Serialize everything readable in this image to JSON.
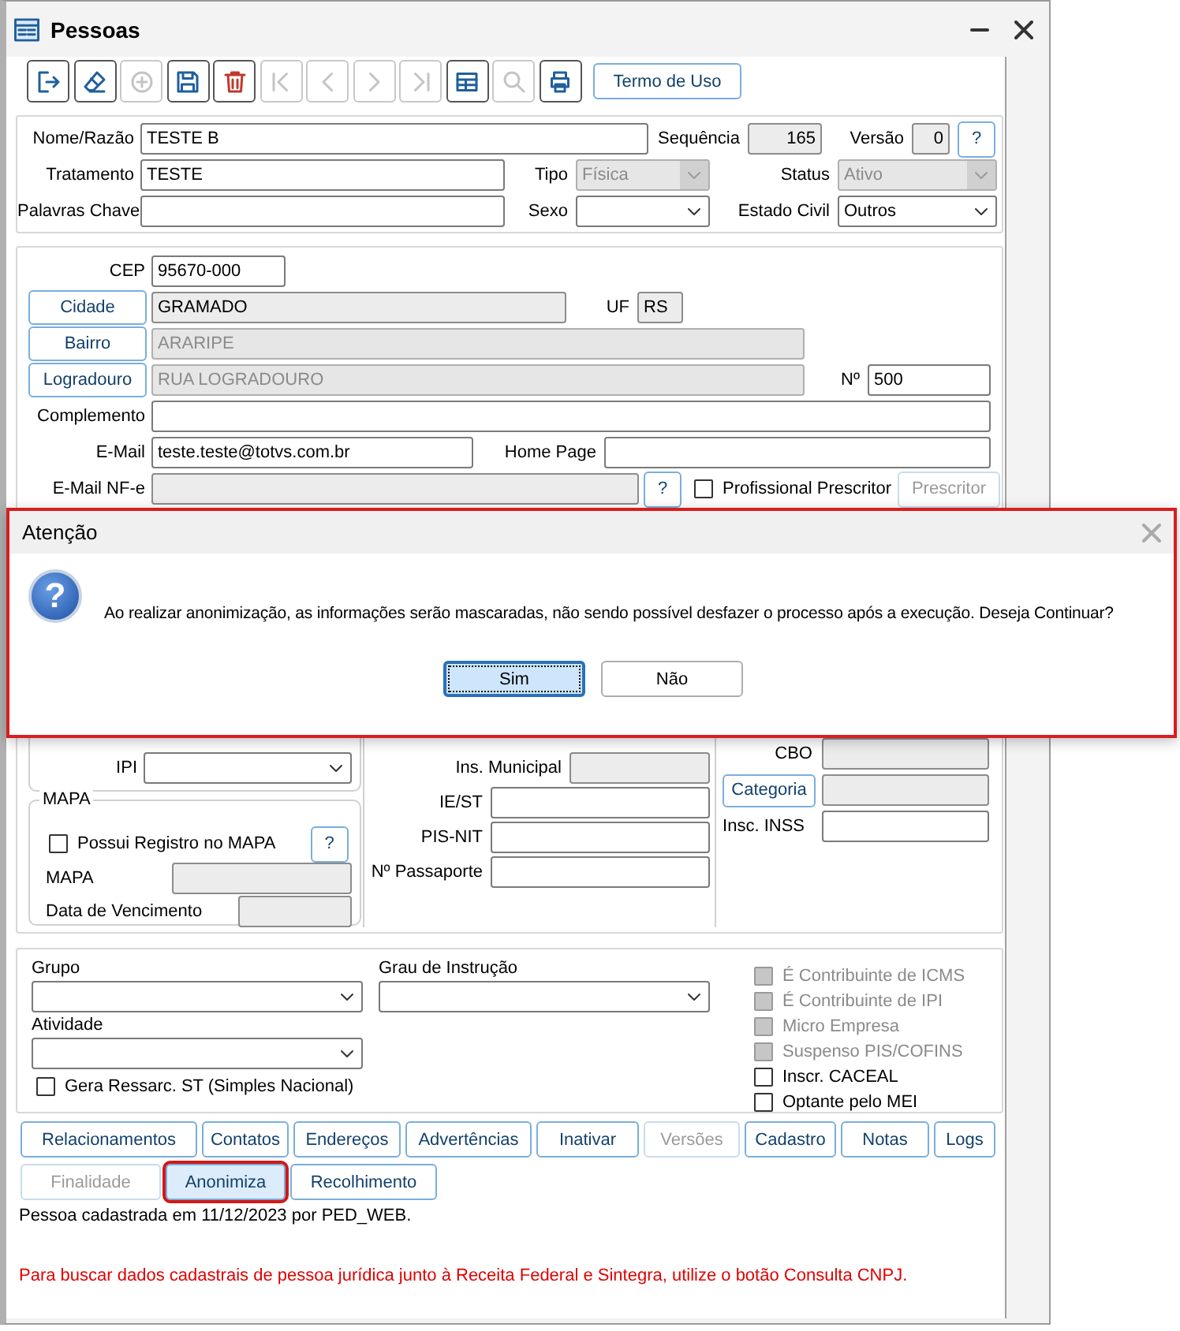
{
  "window": {
    "title": "Pessoas"
  },
  "toolbar": {
    "tools": [
      {
        "kind": "exit",
        "disabled": false
      },
      {
        "kind": "eraser",
        "disabled": false
      },
      {
        "kind": "add",
        "disabled": true
      },
      {
        "kind": "save",
        "disabled": false
      },
      {
        "kind": "delete",
        "disabled": false
      },
      {
        "kind": "first",
        "disabled": true
      },
      {
        "kind": "prev",
        "disabled": true
      },
      {
        "kind": "next",
        "disabled": true
      },
      {
        "kind": "last",
        "disabled": true
      },
      {
        "kind": "grid",
        "disabled": false
      },
      {
        "kind": "search",
        "disabled": true
      },
      {
        "kind": "print",
        "disabled": false
      }
    ],
    "terms_button": "Termo de Uso"
  },
  "identity": {
    "name": {
      "label": "Nome/Razão",
      "value": "TESTE B",
      "readonly": false,
      "disabled": false
    },
    "sequence": {
      "label": "Sequência",
      "value": "165",
      "readonly": true,
      "disabled": false
    },
    "version": {
      "label": "Versão",
      "value": "0",
      "readonly": true,
      "disabled": false
    },
    "help_button": "?",
    "treatment": {
      "label": "Tratamento",
      "value": "TESTE",
      "readonly": false,
      "disabled": false
    },
    "type": {
      "label": "Tipo",
      "value": "Física",
      "disabled": true
    },
    "status": {
      "label": "Status",
      "value": "Ativo",
      "disabled": true
    },
    "keywords": {
      "label": "Palavras Chave",
      "readonly": false,
      "disabled": false
    },
    "sex": {
      "label": "Sexo",
      "readonly": false,
      "disabled": false
    },
    "marital_status": {
      "label": "Estado Civil",
      "value": "Outros",
      "readonly": false,
      "disabled": false
    }
  },
  "address": {
    "cep": {
      "label": "CEP",
      "value": "95670-000",
      "readonly": false,
      "disabled": false
    },
    "city": {
      "button": "Cidade",
      "value": "GRAMADO",
      "readonly": true,
      "disabled": false
    },
    "uf": {
      "label": "UF",
      "value": "RS",
      "readonly": true,
      "disabled": false
    },
    "district": {
      "button": "Bairro",
      "value": "ARARIPE",
      "disabled": true
    },
    "street": {
      "button": "Logradouro",
      "value": "RUA LOGRADOURO",
      "disabled": true
    },
    "number": {
      "label": "Nº",
      "value": "500",
      "readonly": false,
      "disabled": false
    },
    "complement": {
      "label": "Complemento",
      "readonly": false,
      "disabled": false
    },
    "email": {
      "label": "E-Mail",
      "value": "teste.teste@totvs.com.br",
      "readonly": false,
      "disabled": false
    },
    "home_page": {
      "label": "Home Page",
      "readonly": false,
      "disabled": false
    },
    "email_nfe": {
      "label": "E-Mail NF-e",
      "readonly": true,
      "disabled": false
    },
    "help_button": "?",
    "prescriber_checkbox": {
      "label": "Profissional Prescritor",
      "checked": false,
      "disabled": false
    },
    "prescriber_button": {
      "label": "Prescritor",
      "disabled": true
    }
  },
  "tax": {
    "ipi": {
      "label": "IPI",
      "readonly": false,
      "disabled": false
    }
  },
  "mapa": {
    "title": "MAPA",
    "registered_checkbox": {
      "label": "Possui Registro no MAPA",
      "checked": false,
      "disabled": false
    },
    "help_button": "?",
    "mapa": {
      "label": "MAPA",
      "readonly": true,
      "disabled": false
    },
    "due_date": {
      "label": "Data de Vencimento",
      "readonly": true,
      "disabled": false
    }
  },
  "documents": {
    "municipal": {
      "label": "Ins. Municipal",
      "readonly": true,
      "disabled": false
    },
    "ie_st": {
      "label": "IE/ST",
      "readonly": false,
      "disabled": false
    },
    "pis_nit": {
      "label": "PIS-NIT",
      "readonly": false,
      "disabled": false
    },
    "passport": {
      "label": "Nº Passaporte",
      "readonly": false,
      "disabled": false
    }
  },
  "professional": {
    "cbo": {
      "label": "CBO",
      "readonly": true,
      "disabled": false
    },
    "category": {
      "button": "Categoria",
      "readonly": true,
      "disabled": false
    },
    "inss": {
      "label": "Insc. INSS",
      "readonly": false,
      "disabled": false
    }
  },
  "classification": {
    "group": {
      "label": "Grupo",
      "readonly": false,
      "disabled": false
    },
    "education": {
      "label": "Grau de Instrução",
      "readonly": false,
      "disabled": false
    },
    "activity": {
      "label": "Atividade",
      "readonly": false,
      "disabled": false
    },
    "ressarc_checkbox": {
      "label": "Gera Ressarc. ST (Simples Nacional)",
      "checked": false,
      "disabled": false
    },
    "flags": [
      {
        "label": "É Contribuinte de ICMS",
        "checked": false,
        "disabled": true
      },
      {
        "label": "É Contribuinte de IPI",
        "checked": false,
        "disabled": true
      },
      {
        "label": "Micro Empresa",
        "checked": false,
        "disabled": true
      },
      {
        "label": "Suspenso PIS/COFINS",
        "checked": false,
        "disabled": true
      },
      {
        "label": "Inscr. CACEAL",
        "checked": false,
        "disabled": false
      },
      {
        "label": "Optante pelo MEI",
        "checked": false,
        "disabled": false
      }
    ]
  },
  "actions": [
    [
      {
        "label": "Relacionamentos",
        "disabled": false,
        "highlighted": false
      },
      {
        "label": "Contatos",
        "disabled": false,
        "highlighted": false
      },
      {
        "label": "Endereços",
        "disabled": false,
        "highlighted": false
      },
      {
        "label": "Advertências",
        "disabled": false,
        "highlighted": false
      },
      {
        "label": "Inativar",
        "disabled": false,
        "highlighted": false
      },
      {
        "label": "Versões",
        "disabled": true,
        "highlighted": false
      },
      {
        "label": "Cadastro",
        "disabled": false,
        "highlighted": false
      },
      {
        "label": "Notas",
        "disabled": false,
        "highlighted": false
      },
      {
        "label": "Logs",
        "disabled": false,
        "highlighted": false
      }
    ],
    [
      {
        "label": "Finalidade",
        "disabled": true,
        "highlighted": false
      },
      {
        "label": "Anonimiza",
        "disabled": false,
        "highlighted": true
      },
      {
        "label": "Recolhimento",
        "disabled": false,
        "highlighted": false
      }
    ]
  ],
  "created_note": "Pessoa cadastrada em 11/12/2023 por PED_WEB.",
  "hint": "Para buscar dados cadastrais de pessoa jurídica junto à Receita Federal e Sintegra, utilize o botão Consulta CNPJ.",
  "dialog": {
    "title": "Atenção",
    "icon": "?",
    "highlighted": true,
    "message": "Ao realizar anonimização, as informações serão mascaradas, não sendo possível desfazer o processo após a execução. Deseja Continuar?",
    "buttons": [
      {
        "label": "Sim",
        "focused": true
      },
      {
        "label": "Não",
        "focused": false
      }
    ]
  }
}
